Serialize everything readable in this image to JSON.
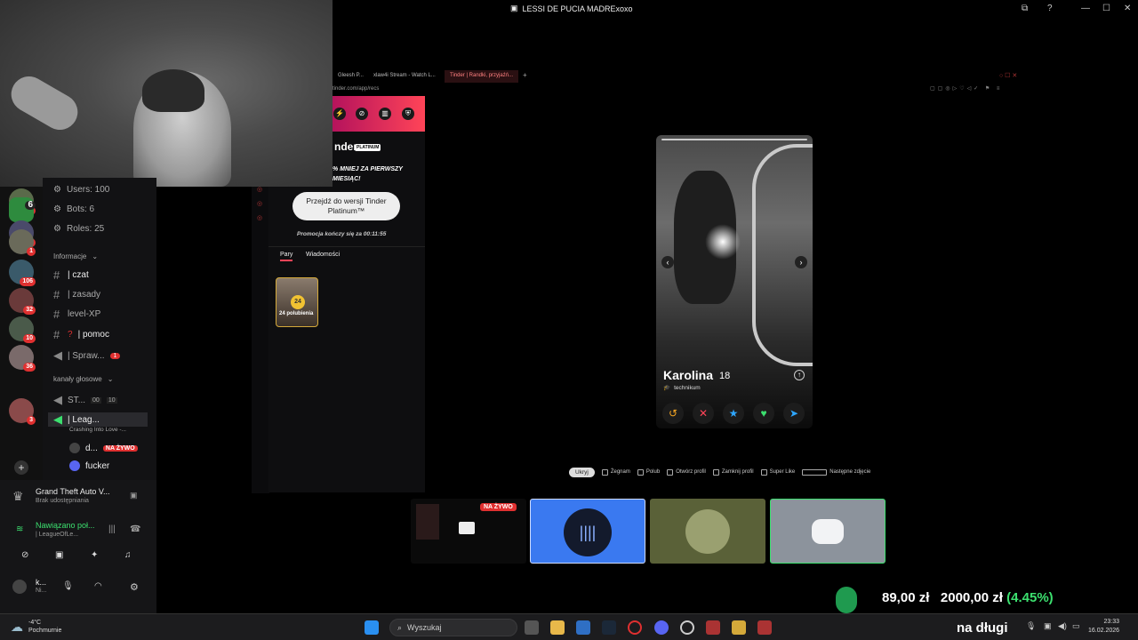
{
  "window": {
    "title": "LESSI DE PUCIA MADRExoxo"
  },
  "browser": {
    "tabs": [
      {
        "label": "Gleesh P..."
      },
      {
        "label": "xlaw4i Stream - Watch L..."
      },
      {
        "label": "Tinder | Randki, przyjaźń..."
      }
    ],
    "url": "tinder.com/app/recs"
  },
  "discord": {
    "stats": {
      "users": "Users: 100",
      "bots": "Bots: 6",
      "roles": "Roles: 25"
    },
    "categories": {
      "info": "Informacje",
      "voice": "kanały głosowe"
    },
    "channels": [
      {
        "name": "| czat"
      },
      {
        "name": "| zasady"
      },
      {
        "name": "level-XP"
      },
      {
        "name": "| pomoc"
      },
      {
        "name": "| Spraw..."
      }
    ],
    "voice_channels": [
      {
        "name": "ST...",
        "count_a": "00",
        "count_b": "10"
      },
      {
        "name": "| Leag...",
        "sub": "Crashing Into Love -..."
      }
    ],
    "voice_users": [
      {
        "name": "d...",
        "badge": "NA ŻYWO"
      },
      {
        "name": "fucker"
      }
    ],
    "unread_badge": "1",
    "server_badges": [
      "21",
      "6",
      "211",
      "1",
      "106",
      "32",
      "10",
      "36",
      "3"
    ],
    "activity": {
      "game": "Grand Theft Auto V...",
      "game_status": "Brak udostępniania"
    },
    "connection": {
      "status": "Nawiązano poł...",
      "channel": "| LeagueOfLe..."
    },
    "user": {
      "name": "k...",
      "status": "Ni..."
    }
  },
  "tinder": {
    "brand": "nder",
    "brand_tag": "PLATINUM",
    "promo_line1": "% MNIEJ ZA PIERWSZY",
    "promo_line2": "MIESIĄC!",
    "upgrade_button": "Przejdź do wersji Tinder Platinum™",
    "countdown": "Promocja kończy się za 00:11:55",
    "tabs": {
      "matches": "Pary",
      "messages": "Wiadomości"
    },
    "likes": {
      "count": "24",
      "label": "24 polubienia"
    },
    "profile": {
      "name": "Karolina",
      "age": "18",
      "school": "technikum"
    },
    "hints": {
      "hide": "Ukryj",
      "nope": "Żegnam",
      "like": "Polub",
      "open": "Otwórz profil",
      "close": "Zamknij profil",
      "super": "Super Like",
      "next": "Następne zdjęcie"
    }
  },
  "thumbnails": {
    "live_badge": "NA ŻYWO"
  },
  "donation": {
    "current": "89,00 zł",
    "goal": "2000,00 zł",
    "percent": "(4.45%)",
    "caption": "na długi"
  },
  "taskbar": {
    "weather_temp": "-4°C",
    "weather_desc": "Pochmurnie",
    "search": "Wyszukaj",
    "time": "23:33",
    "date": "16.02.2026"
  },
  "colors": {
    "tinder": "#ff4458",
    "discord_blurple": "#5865f2",
    "live": "#e03030",
    "donation_green": "#3ce06f"
  }
}
